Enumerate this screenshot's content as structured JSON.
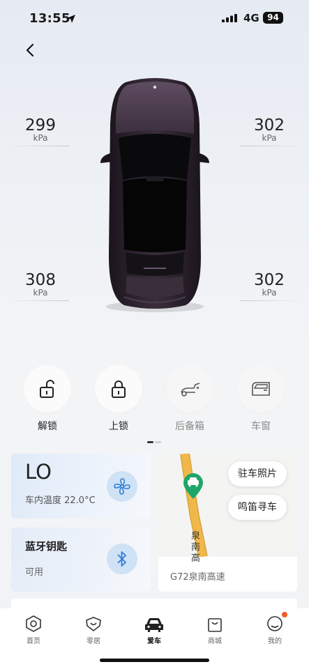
{
  "status_bar": {
    "time": "13:55",
    "network": "4G",
    "battery": "94"
  },
  "tires": {
    "front_left": {
      "value": "299",
      "unit": "kPa"
    },
    "front_right": {
      "value": "302",
      "unit": "kPa"
    },
    "rear_left": {
      "value": "308",
      "unit": "kPa"
    },
    "rear_right": {
      "value": "302",
      "unit": "kPa"
    }
  },
  "controls": [
    {
      "label": "解锁",
      "icon": "unlock-icon"
    },
    {
      "label": "上锁",
      "icon": "lock-icon"
    },
    {
      "label": "后备箱",
      "icon": "trunk-icon"
    },
    {
      "label": "车窗",
      "icon": "window-icon"
    }
  ],
  "climate": {
    "mode": "LO",
    "cabin_temp": "车内温度 22.0°C",
    "icon": "fan-icon"
  },
  "bluetooth_key": {
    "title": "蓝牙钥匙",
    "status": "可用",
    "icon": "bluetooth-icon"
  },
  "map": {
    "parking_photo": "驻车照片",
    "honk_find": "鸣笛寻车",
    "road_label": "泉南高",
    "location": "G72泉南高速"
  },
  "tabs": [
    {
      "label": "首页",
      "icon": "hexagon-icon"
    },
    {
      "label": "零居",
      "icon": "badge-heart-icon"
    },
    {
      "label": "爱车",
      "icon": "car-icon",
      "active": true
    },
    {
      "label": "商城",
      "icon": "shopping-bag-icon"
    },
    {
      "label": "我的",
      "icon": "profile-icon",
      "has_notification": true
    }
  ],
  "colors": {
    "car_body": "#2f2431",
    "accent_blue": "#cfe2f6",
    "map_road": "#f0b84a",
    "map_pin": "#1ea66a",
    "notification": "#f05a24"
  }
}
